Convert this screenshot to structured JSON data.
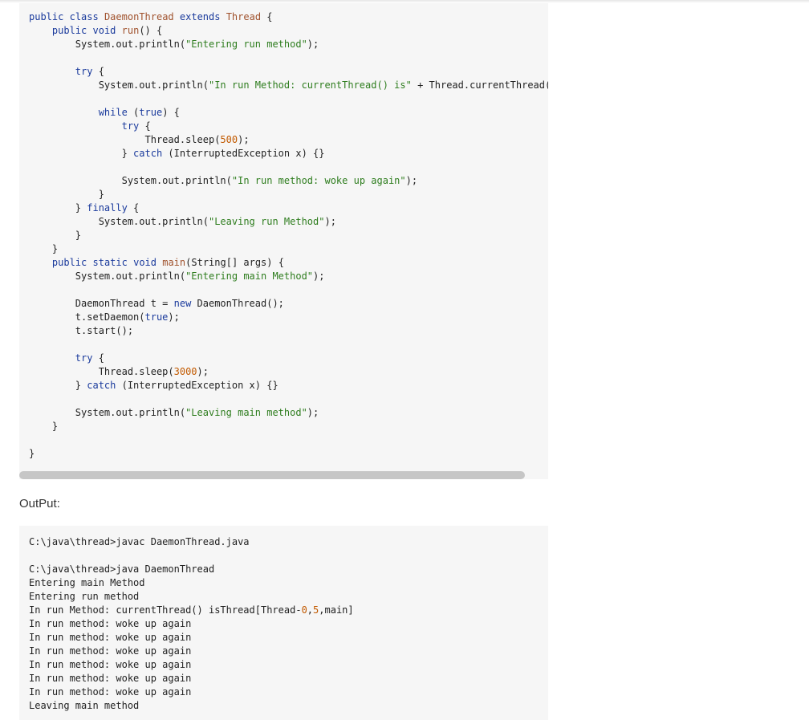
{
  "code_lines": [
    "public class DaemonThread extends Thread {",
    "    public void run() {",
    "        System.out.println(\"Entering run method\");",
    "",
    "        try {",
    "            System.out.println(\"In run Method: currentThread() is\" + Thread.currentThread());",
    "",
    "            while (true) {",
    "                try {",
    "                    Thread.sleep(500);",
    "                } catch (InterruptedException x) {}",
    "",
    "                System.out.println(\"In run method: woke up again\");",
    "            }",
    "        } finally {",
    "            System.out.println(\"Leaving run Method\");",
    "        }",
    "    }",
    "    public static void main(String[] args) {",
    "        System.out.println(\"Entering main Method\");",
    "",
    "        DaemonThread t = new DaemonThread();",
    "        t.setDaemon(true);",
    "        t.start();",
    "",
    "        try {",
    "            Thread.sleep(3000);",
    "        } catch (InterruptedException x) {}",
    "",
    "        System.out.println(\"Leaving main method\");",
    "    }",
    "",
    "}"
  ],
  "output_label": "OutPut:",
  "output_lines": [
    "C:\\java\\thread>javac DaemonThread.java",
    "",
    "C:\\java\\thread>java DaemonThread",
    "Entering main Method",
    "Entering run method",
    "In run Method: currentThread() isThread[Thread-0,5,main]",
    "In run method: woke up again",
    "In run method: woke up again",
    "In run method: woke up again",
    "In run method: woke up again",
    "In run method: woke up again",
    "In run method: woke up again",
    "Leaving main method"
  ],
  "colors": {
    "code_background": "#f6f6f6",
    "keyword": "#1a3a9c",
    "type": "#a0522d",
    "string": "#2e7d1e",
    "number": "#c25a00",
    "scrollbar_thumb": "#c6c6c6"
  }
}
